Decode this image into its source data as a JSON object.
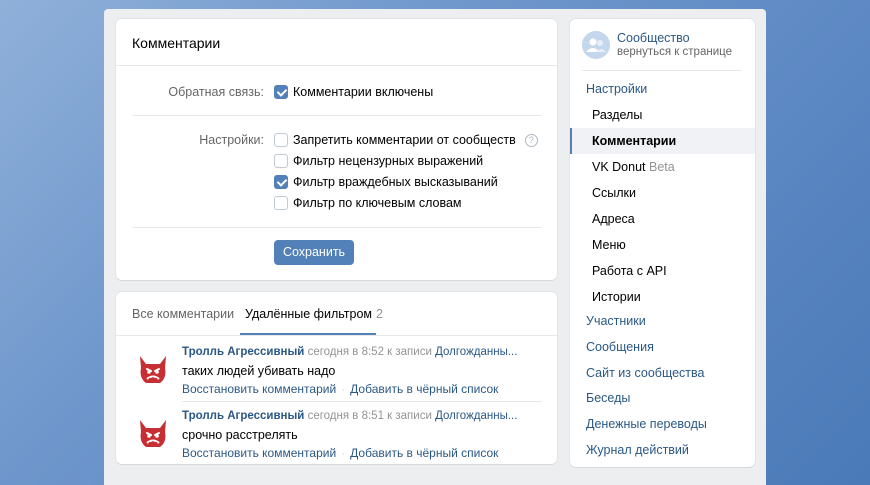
{
  "settings": {
    "title": "Комментарии",
    "feedback_label": "Обратная связь:",
    "feedback_option": "Комментарии включены",
    "settings_label": "Настройки:",
    "options": [
      {
        "label": "Запретить комментарии от сообществ",
        "checked": false
      },
      {
        "label": "Фильтр нецензурных выражений",
        "checked": false
      },
      {
        "label": "Фильтр враждебных высказываний",
        "checked": true
      },
      {
        "label": "Фильтр по ключевым словам",
        "checked": false
      }
    ],
    "help_glyph": "?",
    "save_label": "Сохранить"
  },
  "comments_panel": {
    "tab_all": "Все комментарии",
    "tab_filtered": "Удалённые фильтром",
    "filtered_count": "2",
    "items": [
      {
        "author": "Тролль Агрессивный",
        "meta": "сегодня в 8:52 к записи",
        "post": "Долгожданны...",
        "text": "таких людей убивать надо",
        "restore": "Восстановить комментарий",
        "blacklist": "Добавить в чёрный список"
      },
      {
        "author": "Тролль Агрессивный",
        "meta": "сегодня в 8:51 к записи",
        "post": "Долгожданны...",
        "text": "срочно расстрелять",
        "restore": "Восстановить комментарий",
        "blacklist": "Добавить в чёрный список"
      }
    ],
    "dot": "·"
  },
  "menu": {
    "community_title": "Сообщество",
    "community_sub": "вернуться к странице",
    "items": [
      {
        "label": "Настройки"
      },
      {
        "label": "Разделы"
      },
      {
        "label": "Комментарии"
      },
      {
        "label": "VK Donut",
        "badge": "Beta"
      },
      {
        "label": "Ссылки"
      },
      {
        "label": "Адреса"
      },
      {
        "label": "Меню"
      },
      {
        "label": "Работа с API"
      },
      {
        "label": "Истории"
      },
      {
        "label": "Участники"
      },
      {
        "label": "Сообщения"
      },
      {
        "label": "Сайт из сообщества"
      },
      {
        "label": "Беседы"
      },
      {
        "label": "Денежные переводы"
      },
      {
        "label": "Журнал действий"
      }
    ]
  },
  "colors": {
    "accent": "#5181b8",
    "link": "#2a5885",
    "troll": "#c62f33"
  }
}
